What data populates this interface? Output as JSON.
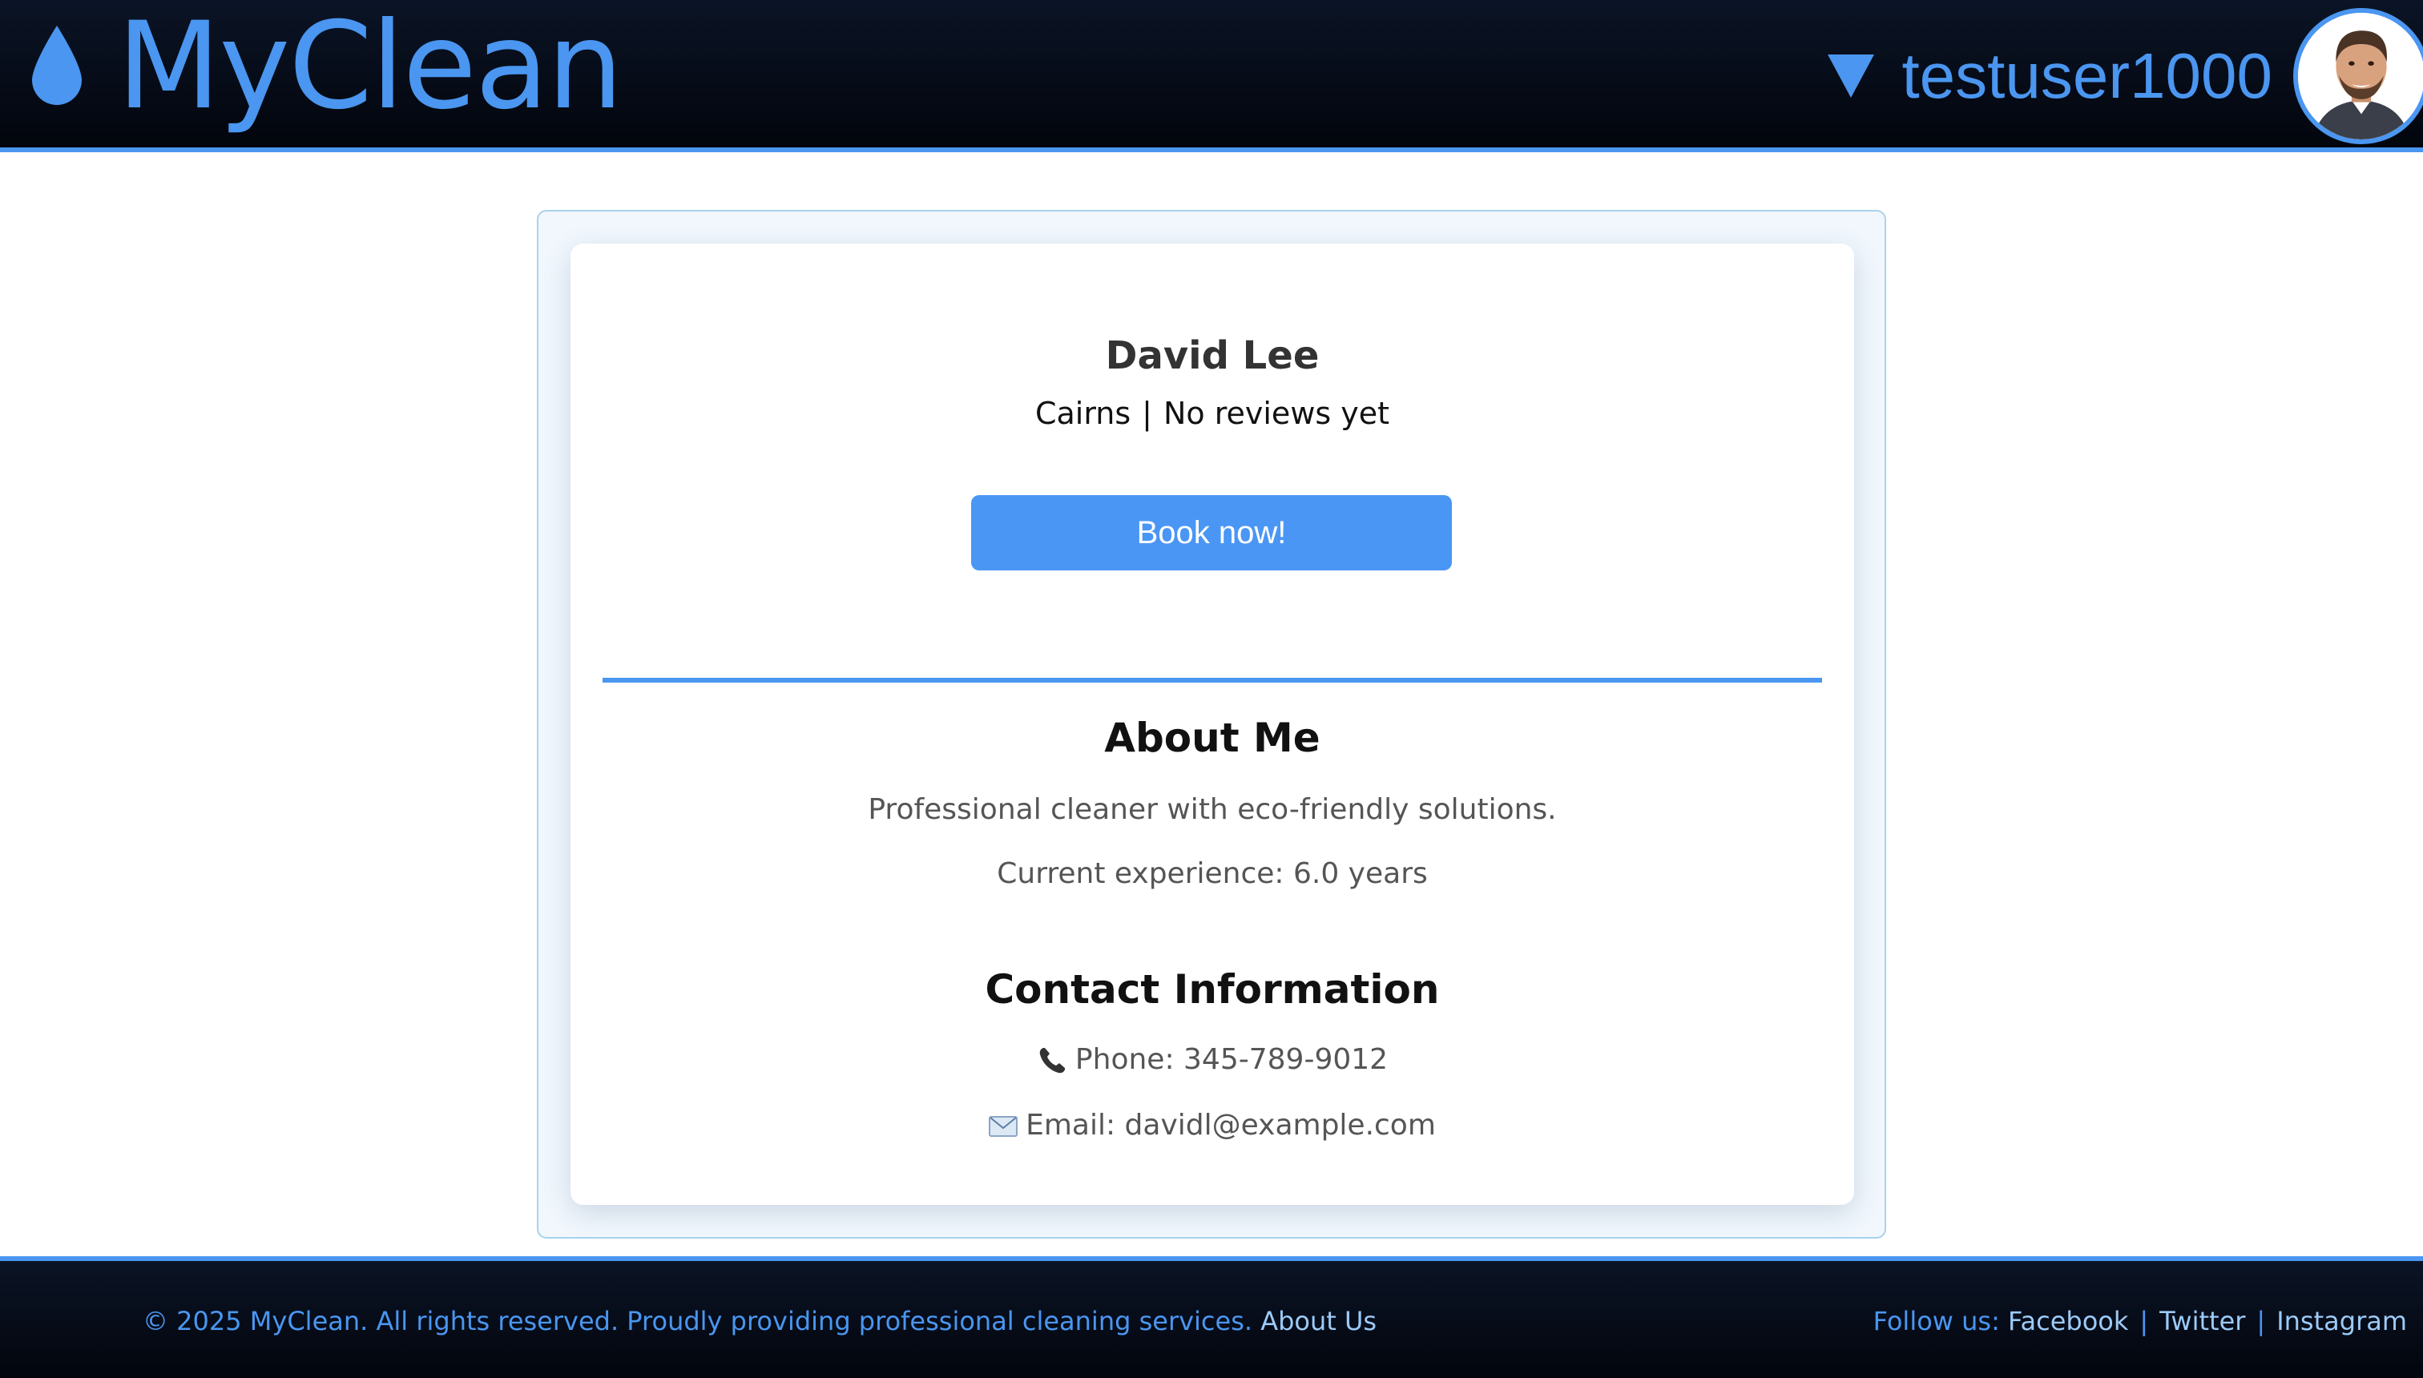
{
  "header": {
    "brand": "MyClean",
    "username": "testuser1000",
    "icons": {
      "logo": "water-drop-icon",
      "menu": "triangle-down-icon",
      "avatar": "user-avatar"
    }
  },
  "profile": {
    "name": "David Lee",
    "location": "Cairns",
    "separator": "|",
    "reviews": "No reviews yet",
    "book_label": "Book now!",
    "about": {
      "title": "About Me",
      "description": "Professional cleaner with eco-friendly solutions.",
      "experience": "Current experience: 6.0 years"
    },
    "contact": {
      "title": "Contact Information",
      "phone_label": "Phone:",
      "phone": "345-789-9012",
      "email_label": "Email:",
      "email": "davidl@example.com",
      "icons": {
        "phone": "telephone-icon",
        "email": "envelope-icon"
      }
    }
  },
  "footer": {
    "copyright": "© 2025 MyClean. All rights reserved. Proudly providing professional cleaning services.",
    "about_link": "About Us",
    "follow_label": "Follow us:",
    "social": [
      "Facebook",
      "Twitter",
      "Instagram"
    ],
    "separator": "|"
  },
  "colors": {
    "accent": "#4a96f0",
    "header_bg": "#02050c",
    "button_bg": "#4a96f5",
    "panel_bg": "#f1f7fd",
    "panel_border": "#a9d2ec"
  }
}
